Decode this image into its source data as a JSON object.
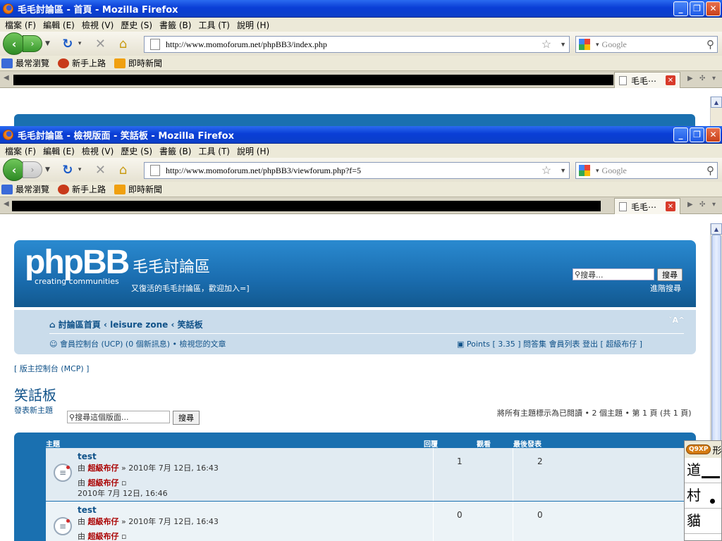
{
  "window1": {
    "title": "毛毛討論區 - 首頁 - Mozilla Firefox",
    "url": "http://www.momoforum.net/phpBB3/index.php",
    "tab_label": "毛毛⋯"
  },
  "window2": {
    "title": "毛毛討論區 - 檢視版面 - 笑話板 - Mozilla Firefox",
    "url": "http://www.momoforum.net/phpBB3/viewforum.php?f=5",
    "tab_label": "毛毛⋯"
  },
  "menu": [
    "檔案 (F)",
    "編輯 (E)",
    "檢視 (V)",
    "歷史 (S)",
    "書籤 (B)",
    "工具 (T)",
    "說明 (H)"
  ],
  "search_placeholder": "Google",
  "bookmarks": [
    {
      "label": "最常瀏覽",
      "icon": "bookmark-folder-icon",
      "color": "#3a6ad8"
    },
    {
      "label": "新手上路",
      "icon": "firefox-icon",
      "color": "#c83a1a"
    },
    {
      "label": "即時新聞",
      "icon": "rss-icon",
      "color": "#f0a010"
    }
  ],
  "header": {
    "logo": "phpBB",
    "logo_sub": "creating communities",
    "site_name": "毛毛討論區",
    "site_desc": "又復活的毛毛討論區，歡迎加入=]",
    "search_placeholder": "搜尋...",
    "search_button": "搜尋",
    "advanced_search": "進階搜尋"
  },
  "nav": {
    "breadcrumb": "討論區首頁 ‹ leisure zone ‹ 笑話板",
    "font_ctrl": "ˇA^",
    "ucp": "會員控制台 (UCP) (0 個新訊息) • 檢視您的文章",
    "right_links": "Points [ 3.35 ]  問答集  會員列表  登出 [ 超級布仔 ]"
  },
  "mcp": "[ 版主控制台 (MCP) ]",
  "forum": {
    "title": "笑話板",
    "new_topic": "發表新主題",
    "search_placeholder": "搜尋這個版面...",
    "search_button": "搜尋",
    "pagination": "將所有主題標示為已閱讀 • 2 個主題 • 第 1 頁 (共 1 頁)"
  },
  "columns": {
    "topic": "主題",
    "replies": "回覆",
    "views": "觀看",
    "last_post": "最後發表"
  },
  "topics": [
    {
      "title": "test",
      "by": "由",
      "author": "超級布仔",
      "date": "» 2010年 7月 12日, 16:43",
      "last_by": "由",
      "last_author": "超級布仔",
      "last_date": "2010年 7月 12日, 16:46",
      "replies": "1",
      "views": "2"
    },
    {
      "title": "test",
      "by": "由",
      "author": "超級布仔",
      "date": "» 2010年 7月 12日, 16:43",
      "last_by": "由",
      "last_author": "超級布仔",
      "last_date": "",
      "replies": "0",
      "views": "0"
    }
  ],
  "ime": {
    "badge": "Q9XP",
    "label": "形",
    "chars": [
      "道",
      "村",
      "貓"
    ]
  }
}
